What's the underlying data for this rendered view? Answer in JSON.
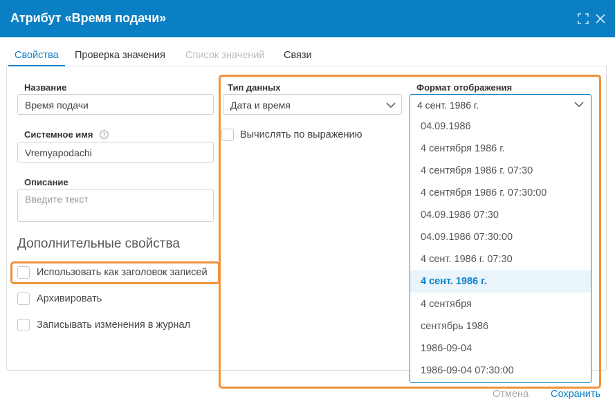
{
  "dialog": {
    "title": "Атрибут «Время подачи»",
    "icons": [
      "expand-icon",
      "close-icon"
    ]
  },
  "tabs": [
    {
      "label": "Свойства",
      "state": "active"
    },
    {
      "label": "Проверка значения",
      "state": "normal"
    },
    {
      "label": "Список значений",
      "state": "disabled"
    },
    {
      "label": "Связи",
      "state": "normal"
    }
  ],
  "left": {
    "name_label": "Название",
    "name_value": "Время подачи",
    "system_name_label": "Системное имя",
    "system_name_value": "Vremyapodachi",
    "description_label": "Описание",
    "description_placeholder": "Введите текст",
    "additional_title": "Дополнительные свойства",
    "checkboxes": [
      {
        "label": "Использовать как заголовок записей",
        "checked": false
      },
      {
        "label": "Архивировать",
        "checked": false
      },
      {
        "label": "Записывать изменения в журнал",
        "checked": false
      }
    ]
  },
  "right": {
    "data_type_label": "Тип данных",
    "data_type_value": "Дата и время",
    "calc_label": "Вычислять по выражению",
    "format_label": "Формат отображения",
    "format_value": "4 сент. 1986 г.",
    "format_options": [
      "04.09.1986",
      "4 сентября 1986 г.",
      "4 сентября 1986 г. 07:30",
      "4 сентября 1986 г. 07:30:00",
      "04.09.1986 07:30",
      "04.09.1986 07:30:00",
      "4 сент. 1986 г. 07:30",
      "4 сент. 1986 г.",
      "4 сентября",
      "сентябрь 1986",
      "1986-09-04",
      "1986-09-04 07:30:00"
    ],
    "selected_option": "4 сент. 1986 г."
  },
  "footer": {
    "cancel_label": "Отмена",
    "save_label": "Сохранить"
  },
  "colors": {
    "accent": "#0b7fc3",
    "highlight": "#f0923a",
    "selected_bg": "#eaf4fb"
  }
}
